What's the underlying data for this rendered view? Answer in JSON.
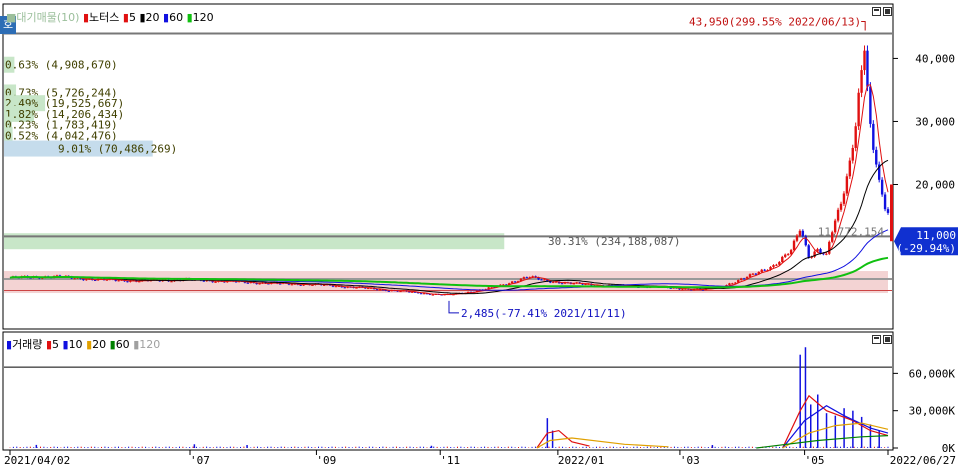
{
  "price_legend": {
    "prefix": "호",
    "items": [
      {
        "label": "대기매물(10)",
        "color": "#9bbf9b"
      },
      {
        "label": "노터스",
        "color": "#e01010"
      },
      {
        "label": "5",
        "color": "#e01010"
      },
      {
        "label": "20",
        "color": "#000000"
      },
      {
        "label": "60",
        "color": "#1010e0"
      },
      {
        "label": "120",
        "color": "#10c010"
      }
    ]
  },
  "volume_legend": {
    "items": [
      {
        "label": "거래량",
        "color": "#1010e0"
      },
      {
        "label": "5",
        "color": "#e01010"
      },
      {
        "label": "10",
        "color": "#1010e0"
      },
      {
        "label": "20",
        "color": "#e0a000"
      },
      {
        "label": "60",
        "color": "#008000"
      },
      {
        "label": "120",
        "color": "#a0a0a0"
      }
    ]
  },
  "colors": {
    "up": "#e01010",
    "down": "#1010e0",
    "ma5": "#e01010",
    "ma20": "#000000",
    "ma60": "#1010e0",
    "ma120": "#10c010",
    "volume_profile": "#c8e6c8",
    "volume_profile_highlight": "#c5dcec",
    "current_price_box": "#1030d0"
  },
  "chart_data": [
    {
      "type": "candlestick",
      "pane": "price",
      "x_range": [
        "2021/04/02",
        "2022/06/27"
      ],
      "y_ticks": [
        "40,000",
        "30,000",
        "20,000"
      ],
      "y_tick_values": [
        40000,
        30000,
        20000
      ],
      "ylim": [
        -1500,
        48000
      ],
      "max_annotation": "43,950(299.55% 2022/06/13)",
      "min_annotation": "2,485(-77.41% 2021/11/11)",
      "current_price": "11,000",
      "current_change": "(-29.94%)",
      "current_value": 11000,
      "ma_end_label": "11,772,154",
      "horizontal_lines": [
        43950,
        11772,
        2485,
        5000
      ],
      "volume_profile": [
        {
          "text": "0.63% (4,908,670)",
          "percent": 0.63,
          "price": 39000
        },
        {
          "text": "0.73% (5,726,244)",
          "percent": 0.73,
          "price": 34600
        },
        {
          "text": "2.49% (19,525,667)",
          "percent": 2.49,
          "price": 32900
        },
        {
          "text": "1.82% (14,206,434)",
          "percent": 1.82,
          "price": 31200
        },
        {
          "text": "0.23% (1,783,419)",
          "percent": 0.23,
          "price": 29500
        },
        {
          "text": "0.52% (4,042,476)",
          "percent": 0.52,
          "price": 27800
        },
        {
          "text": "9.01% (70,486,269)",
          "percent": 9.01,
          "price": 25700
        },
        {
          "text": "30.31% (234,188,087)",
          "percent": 30.31,
          "price": 11000
        },
        {
          "text": "",
          "percent": 53.5,
          "price": 4500
        }
      ],
      "price_path": [
        [
          0,
          5200
        ],
        [
          0.05,
          5400
        ],
        [
          0.1,
          4900
        ],
        [
          0.15,
          4700
        ],
        [
          0.2,
          4900
        ],
        [
          0.25,
          4600
        ],
        [
          0.3,
          4300
        ],
        [
          0.35,
          4100
        ],
        [
          0.4,
          3600
        ],
        [
          0.45,
          3000
        ],
        [
          0.48,
          2600
        ],
        [
          0.5,
          2485
        ],
        [
          0.53,
          3100
        ],
        [
          0.56,
          4000
        ],
        [
          0.59,
          5400
        ],
        [
          0.61,
          4700
        ],
        [
          0.64,
          4300
        ],
        [
          0.67,
          4000
        ],
        [
          0.7,
          3900
        ],
        [
          0.73,
          3800
        ],
        [
          0.76,
          3500
        ],
        [
          0.79,
          3300
        ],
        [
          0.81,
          3800
        ],
        [
          0.83,
          4800
        ],
        [
          0.85,
          5900
        ],
        [
          0.87,
          7200
        ],
        [
          0.89,
          9500
        ],
        [
          0.9,
          13000
        ],
        [
          0.91,
          8500
        ],
        [
          0.92,
          9800
        ],
        [
          0.93,
          8700
        ],
        [
          0.935,
          12000
        ],
        [
          0.945,
          16000
        ],
        [
          0.955,
          22000
        ],
        [
          0.963,
          30000
        ],
        [
          0.968,
          36000
        ],
        [
          0.974,
          43950
        ],
        [
          0.978,
          31000
        ],
        [
          0.982,
          26000
        ],
        [
          0.986,
          24000
        ],
        [
          0.99,
          20000
        ],
        [
          0.995,
          16500
        ],
        [
          1.0,
          15700
        ]
      ],
      "marker_candle": {
        "open": 20000,
        "close": 11000,
        "x_offset": "right-edge"
      }
    },
    {
      "type": "bar",
      "pane": "volume",
      "y_ticks": [
        "60,000K",
        "30,000K",
        "0K"
      ],
      "y_tick_values": [
        60000,
        30000,
        0
      ],
      "ylim": [
        0,
        82000
      ],
      "unit": "K",
      "x_ticks": [
        "2021/04/02",
        "'07",
        "'09",
        "'11",
        "2022/01",
        "'03",
        "'05",
        "2022/06/27"
      ],
      "x_tick_pos": [
        0.0,
        0.205,
        0.349,
        0.49,
        0.624,
        0.763,
        0.905,
        1.0
      ],
      "spikes": [
        {
          "x": 0.03,
          "v": 2500
        },
        {
          "x": 0.21,
          "v": 3000
        },
        {
          "x": 0.27,
          "v": 2400
        },
        {
          "x": 0.48,
          "v": 1800
        },
        {
          "x": 0.612,
          "v": 24000
        },
        {
          "x": 0.618,
          "v": 14000
        },
        {
          "x": 0.8,
          "v": 2400
        },
        {
          "x": 0.9,
          "v": 75000
        },
        {
          "x": 0.906,
          "v": 81000
        },
        {
          "x": 0.912,
          "v": 35000
        },
        {
          "x": 0.92,
          "v": 43000
        },
        {
          "x": 0.93,
          "v": 28000
        },
        {
          "x": 0.94,
          "v": 26000
        },
        {
          "x": 0.95,
          "v": 32000
        },
        {
          "x": 0.96,
          "v": 30000
        },
        {
          "x": 0.97,
          "v": 25000
        },
        {
          "x": 0.98,
          "v": 19000
        },
        {
          "x": 0.99,
          "v": 14000
        }
      ]
    }
  ]
}
